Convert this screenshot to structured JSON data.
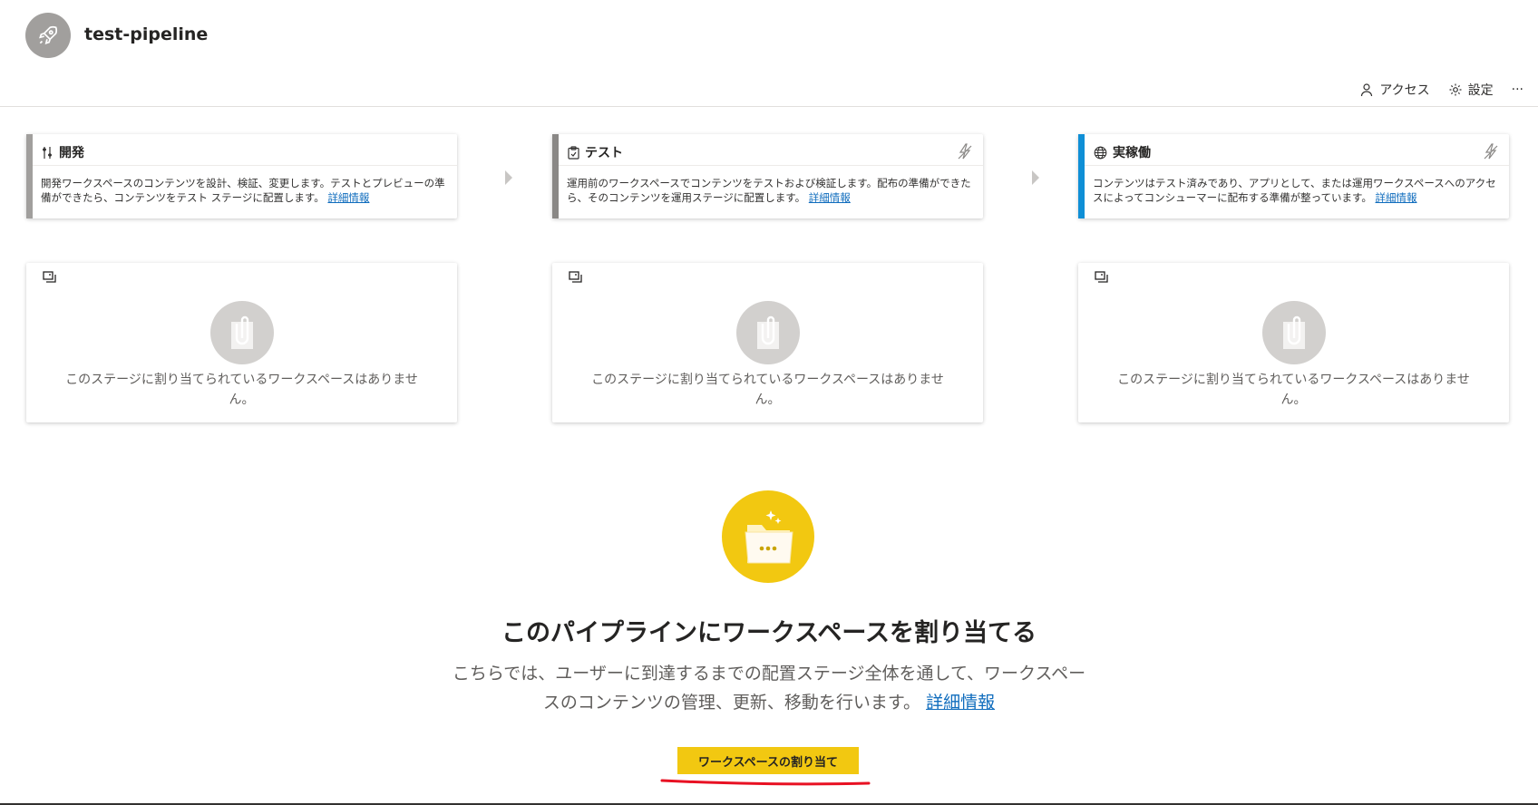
{
  "header": {
    "pipeline_name": "test-pipeline",
    "actions": [
      {
        "label": "アクセス",
        "icon": "person-icon"
      },
      {
        "label": "設定",
        "icon": "gear-icon"
      },
      {
        "label": "···",
        "icon": "more-icon"
      }
    ]
  },
  "stages": [
    {
      "name": "開発",
      "icon": "development-tools-icon",
      "accent_color": "#a19f9d",
      "description": "開発ワークスペースのコンテンツを設計、検証、変更します。テストとプレビューの準備ができたら、コンテンツをテスト ステージに配置します。",
      "link": "詳細情報"
    },
    {
      "name": "テスト",
      "icon": "clipboard-check-icon",
      "accent_color": "#8a8886",
      "description": "運用前のワークスペースでコンテンツをテストおよび検証します。配布の準備ができたら、そのコンテンツを運用ステージに配置します。",
      "link": "詳細情報"
    },
    {
      "name": "実稼働",
      "icon": "globe-icon",
      "accent_color": "#0f8fd6",
      "description": "コンテンツはテスト済みであり、アプリとして、または運用ワークスペースへのアクセスによってコンシューマーに配布する準備が整っています。",
      "link": "詳細情報"
    }
  ],
  "workspace_cards": [
    {
      "empty_text": "このステージに割り当てられているワークスペースはありません。"
    },
    {
      "empty_text": "このステージに割り当てられているワークスペースはありません。"
    },
    {
      "empty_text": "このステージに割り当てられているワークスペースはありません。"
    }
  ],
  "hero": {
    "title": "このパイプラインにワークスペースを割り当てる",
    "subtitle": "こちらでは、ユーザーに到達するまでの配置ステージ全体を通して、ワークスペースのコンテンツの管理、更新、移動を行います。",
    "link": "詳細情報",
    "button_label": "ワークスペースの割り当て"
  },
  "colors": {
    "brand_yellow": "#f2c811",
    "link_blue": "#0f6cbd",
    "annotation_red": "#e81123"
  }
}
